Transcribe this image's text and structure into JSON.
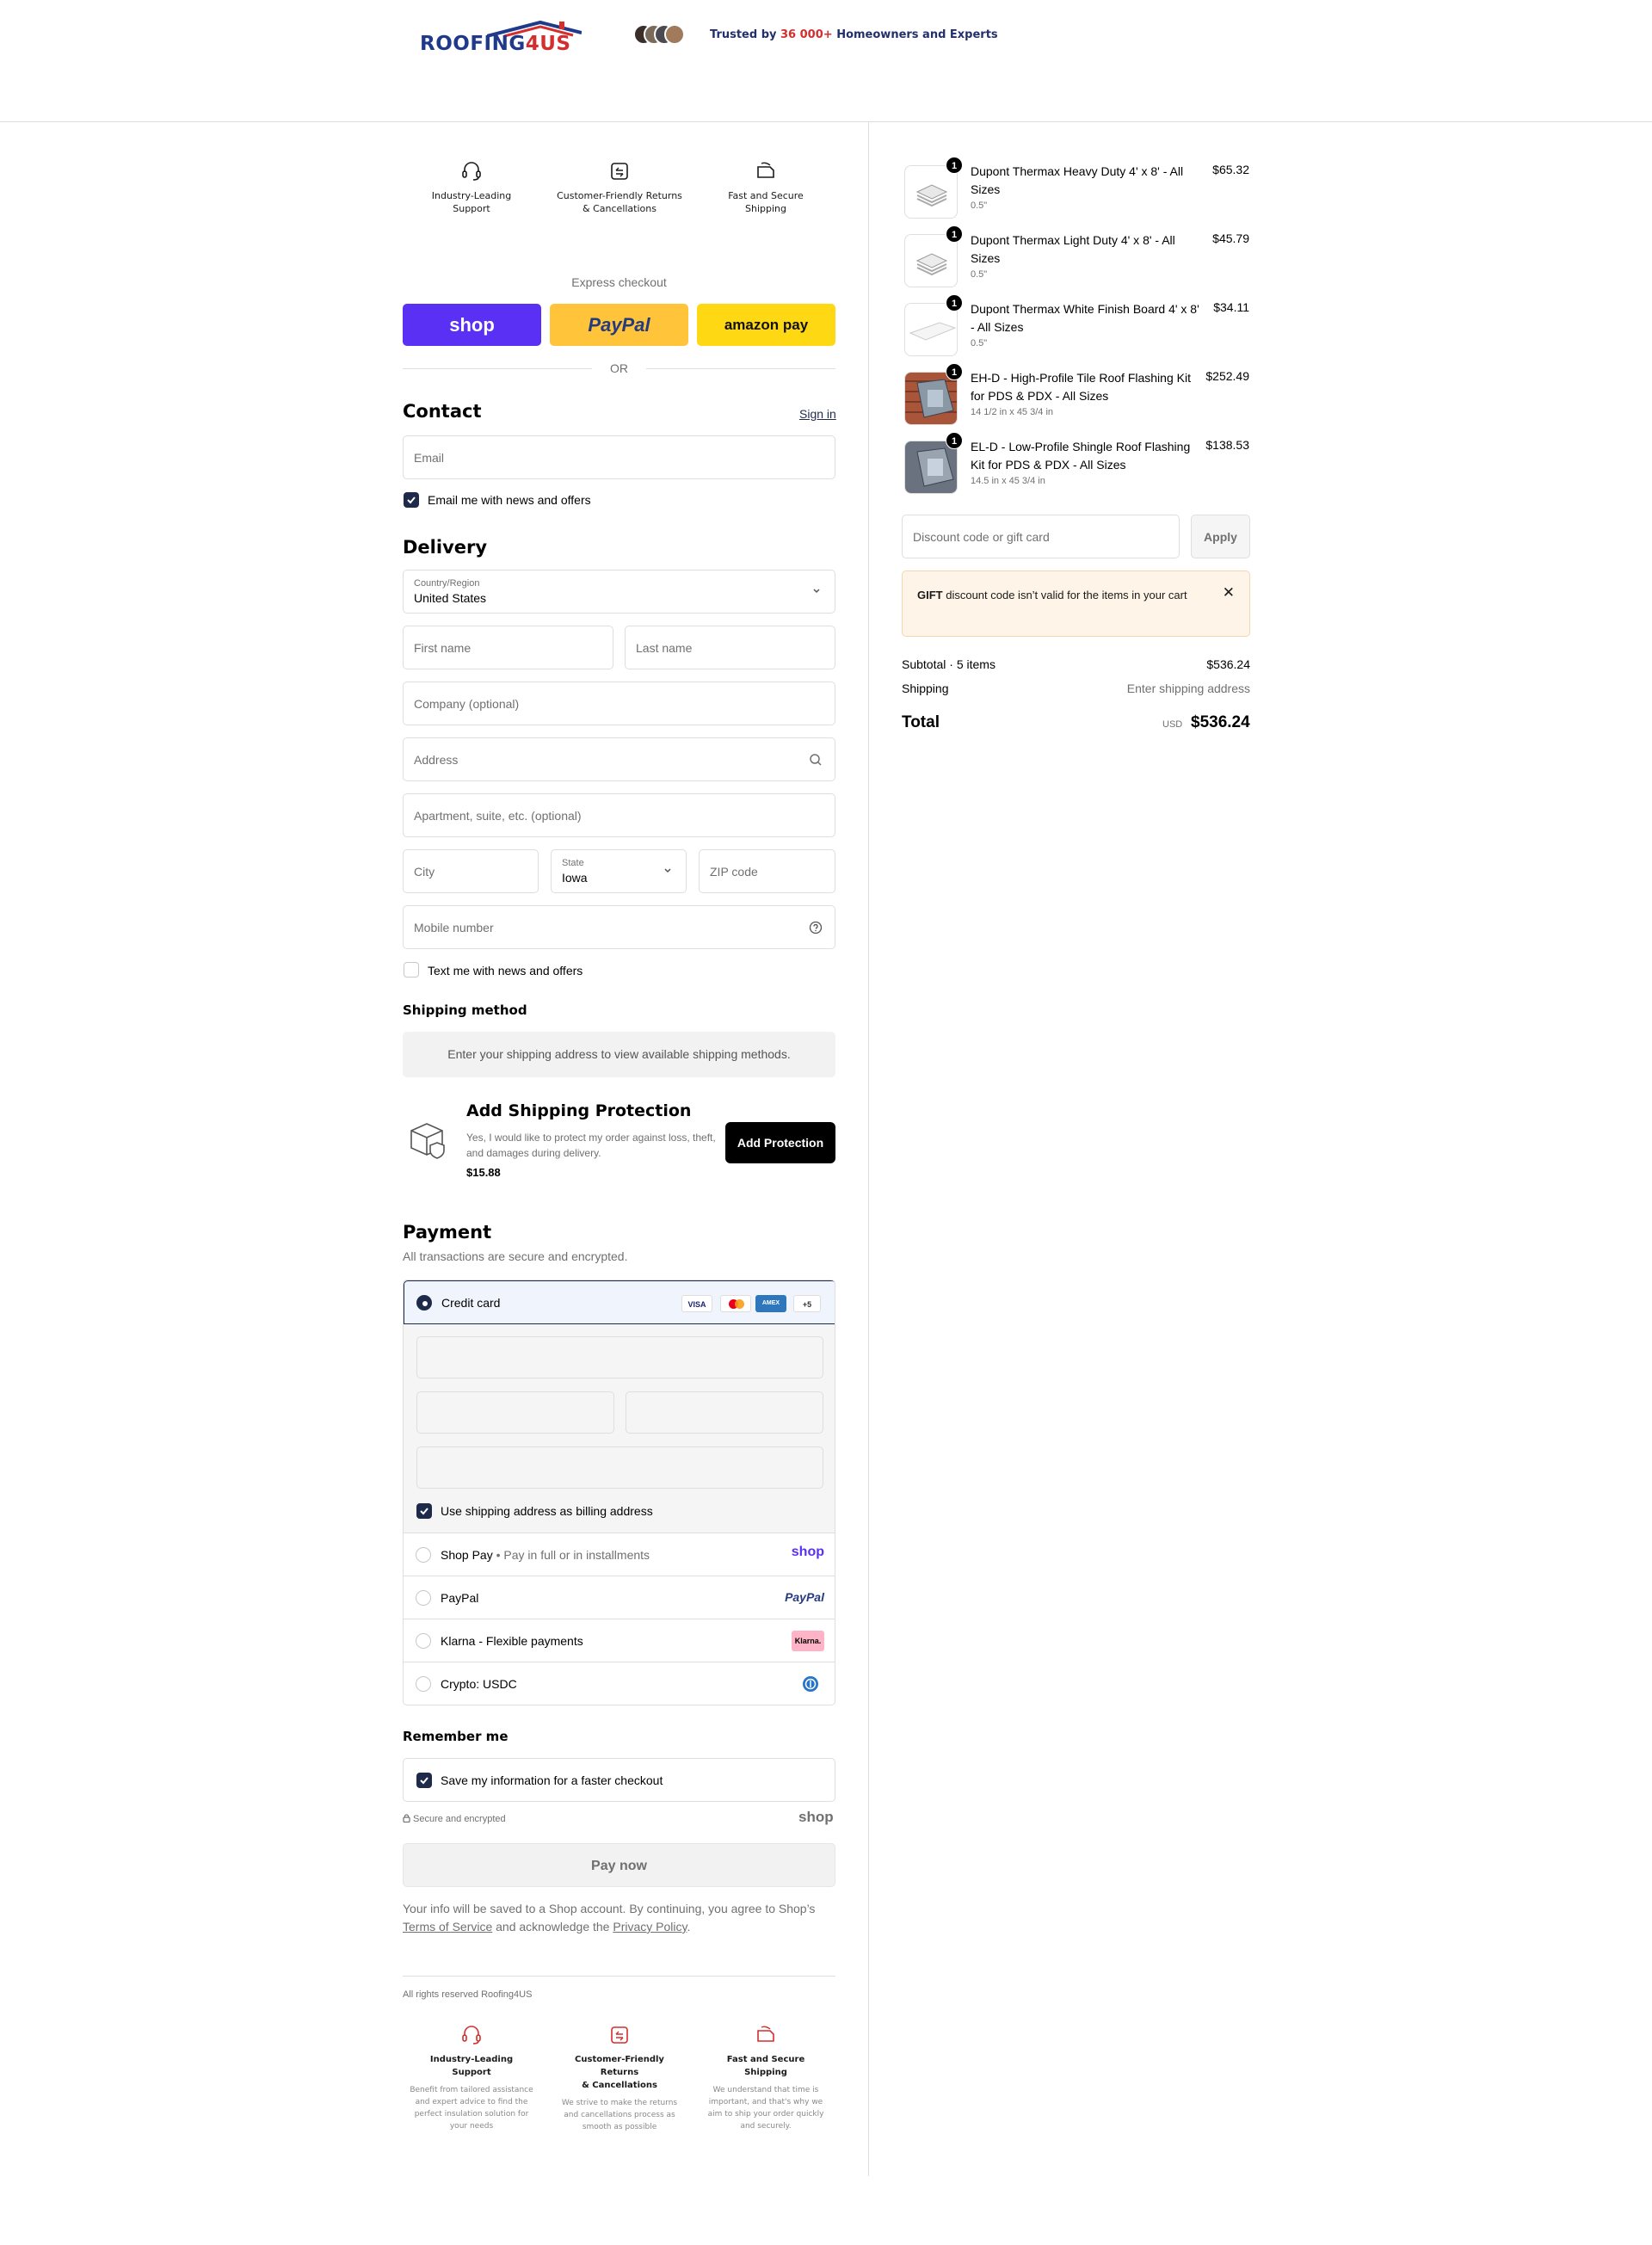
{
  "header": {
    "logo": "ROOFING4US",
    "logo_main": "ROOFING",
    "logo_accent": "4US",
    "trusted_prefix": "Trusted by ",
    "trusted_count": "36 000+",
    "trusted_suffix": " Homeowners and Experts"
  },
  "features": [
    {
      "icon": "headset-icon",
      "line1": "Industry-Leading",
      "line2": "Support"
    },
    {
      "icon": "returns-icon",
      "line1": "Customer-Friendly Returns",
      "line2": "& Cancellations"
    },
    {
      "icon": "shipping-icon",
      "line1": "Fast and Secure",
      "line2": "Shipping"
    }
  ],
  "express": {
    "label": "Express checkout",
    "shop": "shop",
    "paypal": "PayPal",
    "amazon": "amazon pay",
    "or": "OR"
  },
  "contact": {
    "title": "Contact",
    "sign_in": "Sign in",
    "email_placeholder": "Email",
    "news_checkbox": "Email me with news and offers",
    "news_checked": true
  },
  "delivery": {
    "title": "Delivery",
    "country_label": "Country/Region",
    "country_value": "United States",
    "first_name": "First name",
    "last_name": "Last name",
    "company": "Company (optional)",
    "address": "Address",
    "apartment": "Apartment, suite, etc. (optional)",
    "city": "City",
    "state_label": "State",
    "state_value": "Iowa",
    "zip": "ZIP code",
    "mobile": "Mobile number",
    "text_checkbox": "Text me with news and offers",
    "text_checked": false
  },
  "shipping_method": {
    "title": "Shipping method",
    "message": "Enter your shipping address to view available shipping methods."
  },
  "protection": {
    "title": "Add Shipping Protection",
    "description": "Yes, I would like to protect my order against loss, theft, and damages during delivery.",
    "price": "$15.88",
    "button": "Add Protection"
  },
  "payment": {
    "title": "Payment",
    "description": "All transactions are secure and encrypted.",
    "credit_card": "Credit card",
    "card_badges": [
      "VISA",
      "MC",
      "AMEX",
      "+5"
    ],
    "billing_checkbox": "Use shipping address as billing address",
    "methods": [
      {
        "label": "Shop Pay",
        "sub": " • Pay in full or in installments",
        "logo": "shop"
      },
      {
        "label": "PayPal",
        "sub": "",
        "logo": "PayPal"
      },
      {
        "label": "Klarna - Flexible payments",
        "sub": "",
        "logo": "Klarna."
      },
      {
        "label": "Crypto: USDC",
        "sub": "",
        "logo": "usdc-icon"
      }
    ]
  },
  "remember": {
    "title": "Remember me",
    "checkbox": "Save my information for a faster checkout",
    "secure": "Secure and encrypted",
    "shop": "shop"
  },
  "pay_now": "Pay now",
  "consent": {
    "text1": "Your info will be saved to a Shop account. By continuing, you agree to Shop’s ",
    "terms": "Terms of Service",
    "text2": " and acknowledge the ",
    "privacy": "Privacy Policy",
    "text3": "."
  },
  "footer": {
    "rights": "All rights reserved Roofing4US",
    "features": [
      {
        "line1": "Industry-Leading",
        "line2": "Support",
        "desc": "Benefit from tailored assistance and expert advice to find the perfect insulation solution for your needs"
      },
      {
        "line1": "Customer-Friendly Returns",
        "line2": "& Cancellations",
        "desc": "We strive to make the returns and cancellations process as smooth as possible"
      },
      {
        "line1": "Fast and Secure",
        "line2": "Shipping",
        "desc": "We understand that time is important, and that's why we aim to ship your order quickly and securely."
      }
    ]
  },
  "cart": {
    "items": [
      {
        "qty": "1",
        "name": "Dupont Thermax Heavy Duty 4' x 8' - All Sizes",
        "variant": "0.5\"",
        "price": "$65.32"
      },
      {
        "qty": "1",
        "name": "Dupont Thermax Light Duty 4' x 8' - All Sizes",
        "variant": "0.5\"",
        "price": "$45.79"
      },
      {
        "qty": "1",
        "name": "Dupont Thermax White Finish Board 4' x 8' - All Sizes",
        "variant": "0.5\"",
        "price": "$34.11"
      },
      {
        "qty": "1",
        "name": "EH-D - High-Profile Tile Roof Flashing Kit for PDS & PDX - All Sizes",
        "variant": "14 1/2 in x 45 3/4 in",
        "price": "$252.49"
      },
      {
        "qty": "1",
        "name": "EL-D - Low-Profile Shingle Roof Flashing Kit for PDS & PDX - All Sizes",
        "variant": "14.5 in x 45 3/4 in",
        "price": "$138.53"
      }
    ],
    "discount_placeholder": "Discount code or gift card",
    "apply": "Apply",
    "alert_code": "GIFT",
    "alert_text": " discount code isn’t valid for the items in your cart",
    "subtotal_label": "Subtotal · 5 items",
    "subtotal_value": "$536.24",
    "shipping_label": "Shipping",
    "shipping_value": "Enter shipping address",
    "total_label": "Total",
    "currency": "USD",
    "total_value": "$536.24"
  }
}
